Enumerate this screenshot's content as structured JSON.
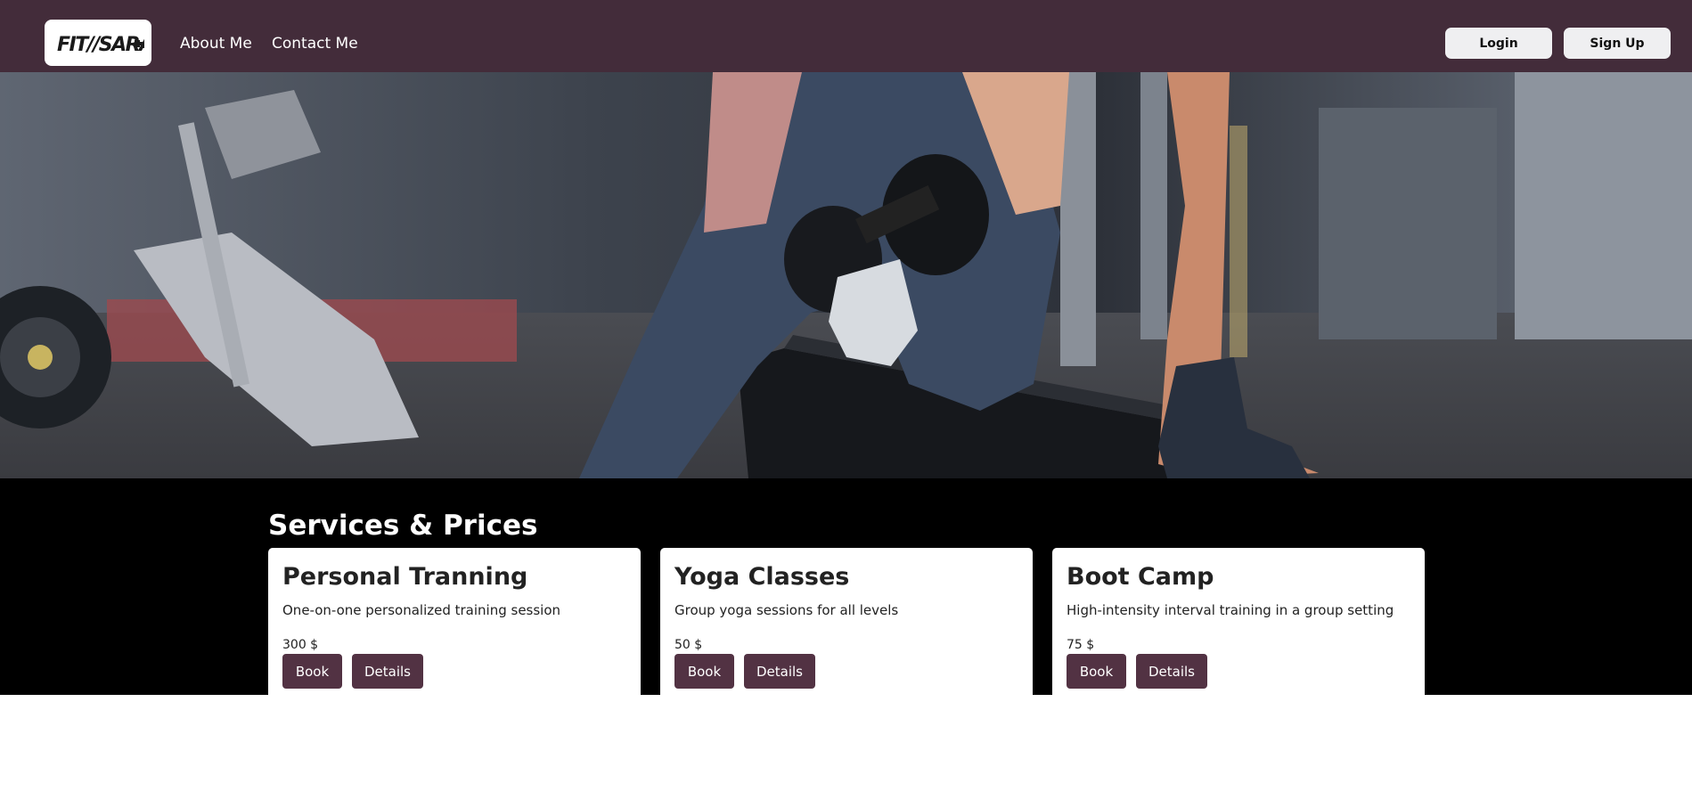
{
  "navbar": {
    "logo_text": "FIT//SARAH",
    "links": [
      "About Me",
      "Contact Me"
    ],
    "login_label": "Login",
    "signup_label": "Sign Up",
    "background": "#432c3a"
  },
  "hero": {
    "image_description_icon": "gym-dumbbell-workout-photo"
  },
  "services": {
    "title": "Services & Prices",
    "cards": [
      {
        "title": "Personal Tranning",
        "description": "One-on-one personalized training session",
        "price": "300 $",
        "book_label": "Book",
        "details_label": "Details"
      },
      {
        "title": "Yoga Classes",
        "description": "Group yoga sessions for all levels",
        "price": "50 $",
        "book_label": "Book",
        "details_label": "Details"
      },
      {
        "title": "Boot Camp",
        "description": "High-intensity interval training in a group setting",
        "price": "75 $",
        "book_label": "Book",
        "details_label": "Details"
      }
    ],
    "accent": "#523243"
  }
}
